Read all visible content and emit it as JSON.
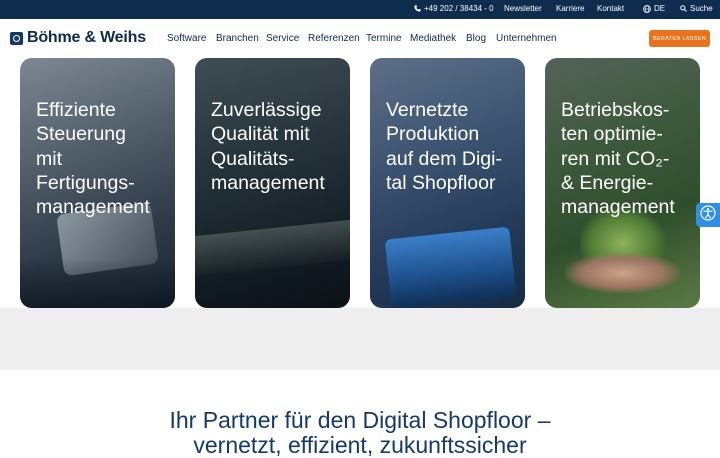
{
  "topbar": {
    "phone": "+49 202 / 38434 - 0",
    "newsletter": "Newsletter",
    "careers": "Karriere",
    "contact": "Kontakt",
    "language": "DE",
    "search": "Suche"
  },
  "header": {
    "logo_text": "Böhme & Weihs",
    "nav": [
      "Software",
      "Branchen",
      "Service",
      "Referenzen",
      "Termine",
      "Mediathek",
      "Blog",
      "Unternehmen"
    ],
    "cta_label": "BERATEN LASSEN"
  },
  "cards": [
    {
      "lines": [
        "Effiziente",
        "Steuerung",
        "mit",
        "Fertigungs-",
        "management"
      ]
    },
    {
      "lines": [
        "Zuverlässige",
        "Qualität mit",
        "Qualitäts-",
        "management"
      ]
    },
    {
      "lines": [
        "Vernetzte",
        "Produktion",
        "auf dem Digi-",
        "tal Shopfloor"
      ]
    },
    {
      "lines": [
        "Betriebskos-",
        "ten optimie-",
        "ren mit CO₂-",
        "& Energie-",
        "management"
      ]
    }
  ],
  "partner": {
    "line1": "Ihr Partner für den Digital Shopfloor –",
    "line2": "vernetzt, effizient, zukunftssicher"
  },
  "icons": {
    "phone": "phone-icon",
    "globe": "globe-icon",
    "search": "search-icon",
    "accessibility": "accessibility-icon"
  },
  "colors": {
    "navy": "#0d2c4e",
    "heading_blue": "#143a66",
    "cta_orange": "#e8731c",
    "widget_blue": "#2f8fe6",
    "band_gray": "#eeeeee"
  }
}
